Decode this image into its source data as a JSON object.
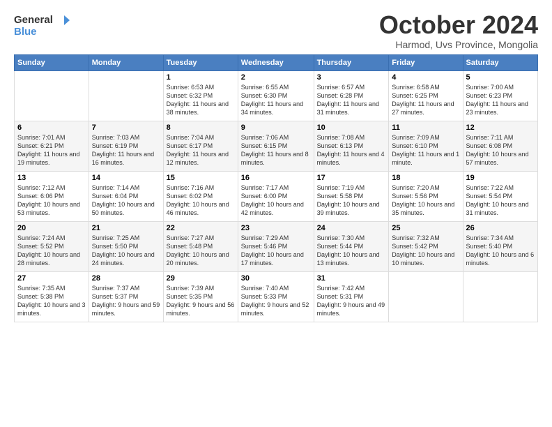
{
  "logo": {
    "general": "General",
    "blue": "Blue"
  },
  "header": {
    "month": "October 2024",
    "location": "Harmod, Uvs Province, Mongolia"
  },
  "days_of_week": [
    "Sunday",
    "Monday",
    "Tuesday",
    "Wednesday",
    "Thursday",
    "Friday",
    "Saturday"
  ],
  "weeks": [
    [
      {
        "day": "",
        "content": ""
      },
      {
        "day": "",
        "content": ""
      },
      {
        "day": "1",
        "content": "Sunrise: 6:53 AM\nSunset: 6:32 PM\nDaylight: 11 hours and 38 minutes."
      },
      {
        "day": "2",
        "content": "Sunrise: 6:55 AM\nSunset: 6:30 PM\nDaylight: 11 hours and 34 minutes."
      },
      {
        "day": "3",
        "content": "Sunrise: 6:57 AM\nSunset: 6:28 PM\nDaylight: 11 hours and 31 minutes."
      },
      {
        "day": "4",
        "content": "Sunrise: 6:58 AM\nSunset: 6:25 PM\nDaylight: 11 hours and 27 minutes."
      },
      {
        "day": "5",
        "content": "Sunrise: 7:00 AM\nSunset: 6:23 PM\nDaylight: 11 hours and 23 minutes."
      }
    ],
    [
      {
        "day": "6",
        "content": "Sunrise: 7:01 AM\nSunset: 6:21 PM\nDaylight: 11 hours and 19 minutes."
      },
      {
        "day": "7",
        "content": "Sunrise: 7:03 AM\nSunset: 6:19 PM\nDaylight: 11 hours and 16 minutes."
      },
      {
        "day": "8",
        "content": "Sunrise: 7:04 AM\nSunset: 6:17 PM\nDaylight: 11 hours and 12 minutes."
      },
      {
        "day": "9",
        "content": "Sunrise: 7:06 AM\nSunset: 6:15 PM\nDaylight: 11 hours and 8 minutes."
      },
      {
        "day": "10",
        "content": "Sunrise: 7:08 AM\nSunset: 6:13 PM\nDaylight: 11 hours and 4 minutes."
      },
      {
        "day": "11",
        "content": "Sunrise: 7:09 AM\nSunset: 6:10 PM\nDaylight: 11 hours and 1 minute."
      },
      {
        "day": "12",
        "content": "Sunrise: 7:11 AM\nSunset: 6:08 PM\nDaylight: 10 hours and 57 minutes."
      }
    ],
    [
      {
        "day": "13",
        "content": "Sunrise: 7:12 AM\nSunset: 6:06 PM\nDaylight: 10 hours and 53 minutes."
      },
      {
        "day": "14",
        "content": "Sunrise: 7:14 AM\nSunset: 6:04 PM\nDaylight: 10 hours and 50 minutes."
      },
      {
        "day": "15",
        "content": "Sunrise: 7:16 AM\nSunset: 6:02 PM\nDaylight: 10 hours and 46 minutes."
      },
      {
        "day": "16",
        "content": "Sunrise: 7:17 AM\nSunset: 6:00 PM\nDaylight: 10 hours and 42 minutes."
      },
      {
        "day": "17",
        "content": "Sunrise: 7:19 AM\nSunset: 5:58 PM\nDaylight: 10 hours and 39 minutes."
      },
      {
        "day": "18",
        "content": "Sunrise: 7:20 AM\nSunset: 5:56 PM\nDaylight: 10 hours and 35 minutes."
      },
      {
        "day": "19",
        "content": "Sunrise: 7:22 AM\nSunset: 5:54 PM\nDaylight: 10 hours and 31 minutes."
      }
    ],
    [
      {
        "day": "20",
        "content": "Sunrise: 7:24 AM\nSunset: 5:52 PM\nDaylight: 10 hours and 28 minutes."
      },
      {
        "day": "21",
        "content": "Sunrise: 7:25 AM\nSunset: 5:50 PM\nDaylight: 10 hours and 24 minutes."
      },
      {
        "day": "22",
        "content": "Sunrise: 7:27 AM\nSunset: 5:48 PM\nDaylight: 10 hours and 20 minutes."
      },
      {
        "day": "23",
        "content": "Sunrise: 7:29 AM\nSunset: 5:46 PM\nDaylight: 10 hours and 17 minutes."
      },
      {
        "day": "24",
        "content": "Sunrise: 7:30 AM\nSunset: 5:44 PM\nDaylight: 10 hours and 13 minutes."
      },
      {
        "day": "25",
        "content": "Sunrise: 7:32 AM\nSunset: 5:42 PM\nDaylight: 10 hours and 10 minutes."
      },
      {
        "day": "26",
        "content": "Sunrise: 7:34 AM\nSunset: 5:40 PM\nDaylight: 10 hours and 6 minutes."
      }
    ],
    [
      {
        "day": "27",
        "content": "Sunrise: 7:35 AM\nSunset: 5:38 PM\nDaylight: 10 hours and 3 minutes."
      },
      {
        "day": "28",
        "content": "Sunrise: 7:37 AM\nSunset: 5:37 PM\nDaylight: 9 hours and 59 minutes."
      },
      {
        "day": "29",
        "content": "Sunrise: 7:39 AM\nSunset: 5:35 PM\nDaylight: 9 hours and 56 minutes."
      },
      {
        "day": "30",
        "content": "Sunrise: 7:40 AM\nSunset: 5:33 PM\nDaylight: 9 hours and 52 minutes."
      },
      {
        "day": "31",
        "content": "Sunrise: 7:42 AM\nSunset: 5:31 PM\nDaylight: 9 hours and 49 minutes."
      },
      {
        "day": "",
        "content": ""
      },
      {
        "day": "",
        "content": ""
      }
    ]
  ]
}
